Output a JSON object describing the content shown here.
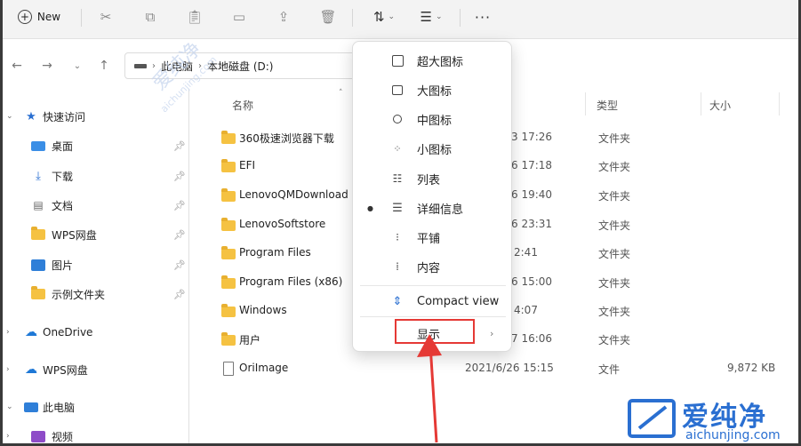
{
  "toolbar": {
    "new_label": "New",
    "more_label": "···"
  },
  "address": {
    "path": [
      "此电脑",
      "本地磁盘 (D:)"
    ]
  },
  "sidebar": {
    "items": [
      {
        "label": "快速访问",
        "icon": "star-icon",
        "pinned": false
      },
      {
        "label": "桌面",
        "icon": "desktop-icon",
        "pinned": true
      },
      {
        "label": "下载",
        "icon": "download-icon",
        "pinned": true
      },
      {
        "label": "文档",
        "icon": "document-icon",
        "pinned": true
      },
      {
        "label": "WPS网盘",
        "icon": "folder-icon",
        "pinned": true
      },
      {
        "label": "图片",
        "icon": "picture-icon",
        "pinned": true
      },
      {
        "label": "示例文件夹",
        "icon": "folder-icon",
        "pinned": true
      },
      {
        "label": "OneDrive",
        "icon": "cloud-icon",
        "pinned": false
      },
      {
        "label": "WPS网盘",
        "icon": "cloud-icon",
        "pinned": false
      },
      {
        "label": "此电脑",
        "icon": "pc-icon",
        "pinned": false
      },
      {
        "label": "视频",
        "icon": "video-icon",
        "pinned": false
      }
    ]
  },
  "columns": {
    "name": "名称",
    "type": "类型",
    "size": "大小"
  },
  "files": [
    {
      "name": "360极速浏览器下载",
      "date": "3 17:26",
      "type": "文件夹",
      "size": "",
      "kind": "folder"
    },
    {
      "name": "EFI",
      "date": "6 17:18",
      "type": "文件夹",
      "size": "",
      "kind": "folder"
    },
    {
      "name": "LenovoQMDownload",
      "date": "6 19:40",
      "type": "文件夹",
      "size": "",
      "kind": "folder"
    },
    {
      "name": "LenovoSoftstore",
      "date": "6 23:31",
      "type": "文件夹",
      "size": "",
      "kind": "folder"
    },
    {
      "name": "Program Files",
      "date": "2:41",
      "type": "文件夹",
      "size": "",
      "kind": "folder"
    },
    {
      "name": "Program Files (x86)",
      "date": "6 15:00",
      "type": "文件夹",
      "size": "",
      "kind": "folder"
    },
    {
      "name": "Windows",
      "date": "4:07",
      "type": "文件夹",
      "size": "",
      "kind": "folder"
    },
    {
      "name": "用户",
      "date": "7 16:06",
      "type": "文件夹",
      "size": "",
      "kind": "folder"
    },
    {
      "name": "OriImage",
      "date": "2021/6/26 15:15",
      "type": "文件",
      "size": "9,872 KB",
      "kind": "file"
    }
  ],
  "view_menu": {
    "items": [
      {
        "label": "超大图标",
        "icon": "extra-large-icons-icon",
        "selected": false
      },
      {
        "label": "大图标",
        "icon": "large-icons-icon",
        "selected": false
      },
      {
        "label": "中图标",
        "icon": "medium-icons-icon",
        "selected": false
      },
      {
        "label": "小图标",
        "icon": "small-icons-icon",
        "selected": false
      },
      {
        "label": "列表",
        "icon": "list-icon",
        "selected": false
      },
      {
        "label": "详细信息",
        "icon": "details-icon",
        "selected": true
      },
      {
        "label": "平铺",
        "icon": "tiles-icon",
        "selected": false
      },
      {
        "label": "内容",
        "icon": "content-icon",
        "selected": false
      }
    ],
    "compact_label": "Compact view",
    "show_label": "显示"
  },
  "watermark": {
    "diag_cn": "爱纯净",
    "diag_en": "aichunjing.com",
    "logo_cn": "爱纯净",
    "logo_en": "aichunjing.com"
  },
  "colors": {
    "accent": "#2a6fd1",
    "highlight": "#e53935",
    "folder": "#f5c242"
  }
}
